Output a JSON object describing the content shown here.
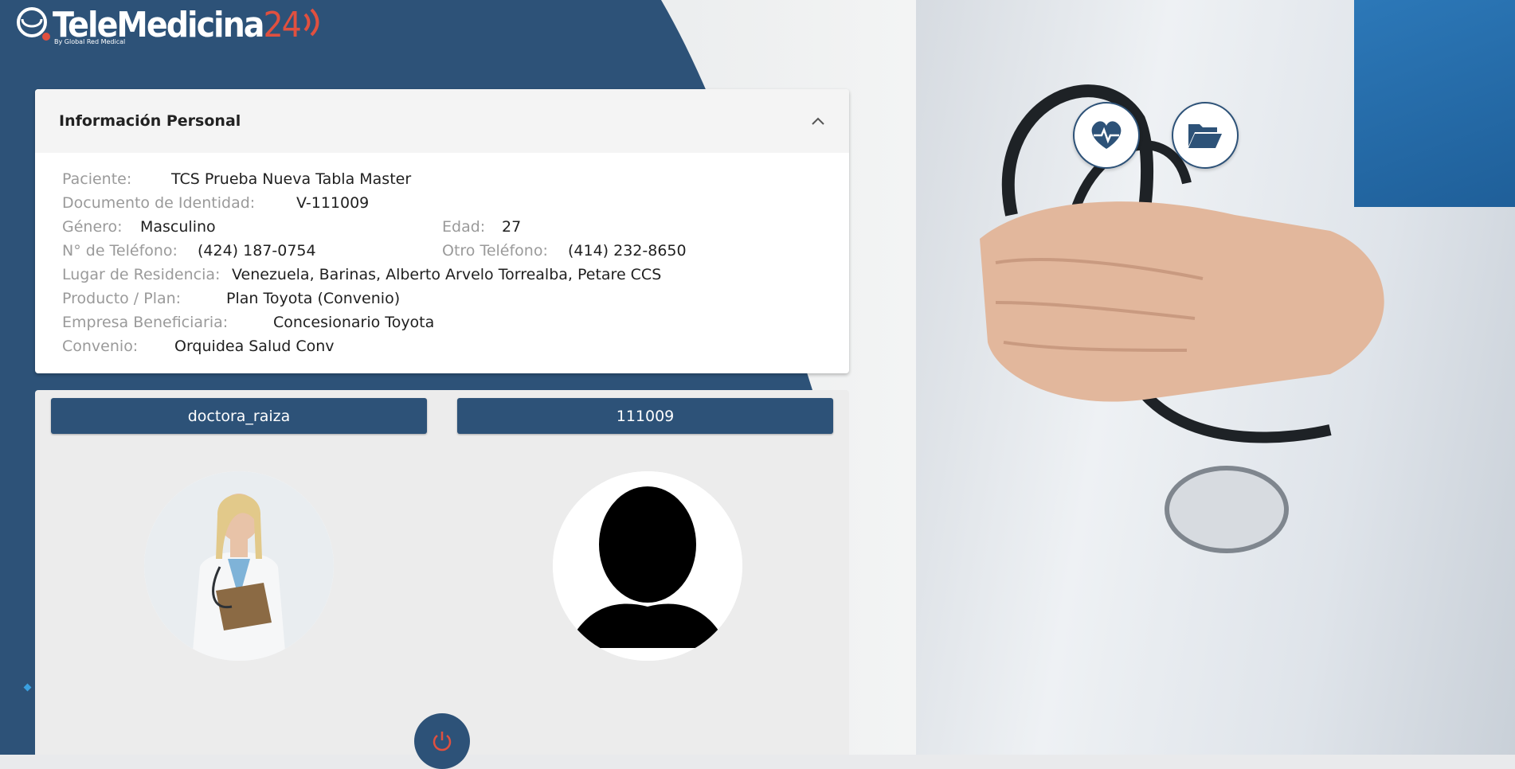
{
  "brand": {
    "name": "TeleMedicina",
    "number": "24",
    "tagline": "By Global Red Medical"
  },
  "personal_info": {
    "title": "Información Personal",
    "fields": {
      "paciente": {
        "label": "Paciente:",
        "value": "TCS Prueba Nueva Tabla Master"
      },
      "documento": {
        "label": "Documento de Identidad:",
        "value": "V-111009"
      },
      "genero": {
        "label": "Género:",
        "value": "Masculino"
      },
      "edad": {
        "label": "Edad:",
        "value": "27"
      },
      "telefono": {
        "label": "N° de Teléfono:",
        "value": "(424) 187-0754"
      },
      "otro_telefono": {
        "label": "Otro Teléfono:",
        "value": "(414) 232-8650"
      },
      "residencia": {
        "label": "Lugar de Residencia:",
        "value": "Venezuela, Barinas, Alberto Arvelo Torrealba, Petare CCS"
      },
      "producto": {
        "label": "Producto / Plan:",
        "value": "Plan Toyota (Convenio)"
      },
      "empresa": {
        "label": "Empresa Beneficiaria:",
        "value": "Concesionario Toyota"
      },
      "convenio": {
        "label": "Convenio:",
        "value": "Orquidea Salud Conv"
      }
    }
  },
  "call_panel": {
    "doctor_username": "doctora_raiza",
    "patient_id": "111009"
  },
  "icons": {
    "collapse": "chevron-up-icon",
    "vitals": "heart-pulse-icon",
    "records": "folder-open-icon",
    "power": "power-icon"
  },
  "colors": {
    "brand_blue": "#2d5278",
    "accent_red": "#e0503f"
  }
}
